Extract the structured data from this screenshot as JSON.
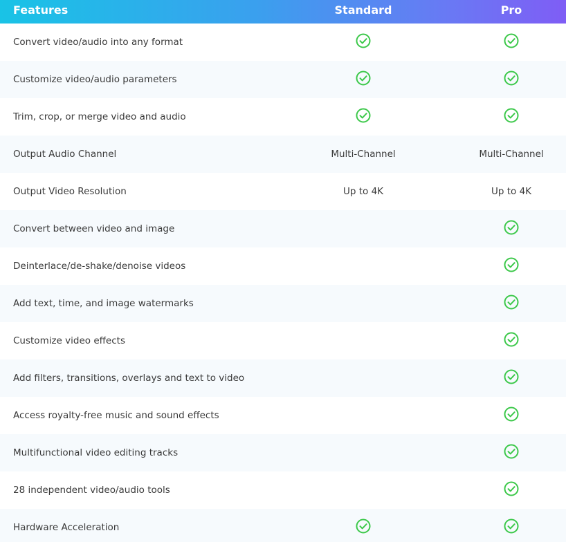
{
  "header": {
    "features": "Features",
    "standard": "Standard",
    "pro": "Pro"
  },
  "colors": {
    "check": "#3cc84a",
    "header_gradient_start": "#19c3e6",
    "header_gradient_end": "#7f5df5"
  },
  "rows": [
    {
      "feature": "Convert video/audio into any format",
      "standard": "check-icon",
      "pro": "check-icon"
    },
    {
      "feature": "Customize video/audio parameters",
      "standard": "check-icon",
      "pro": "check-icon"
    },
    {
      "feature": "Trim, crop, or merge video and audio",
      "standard": "check-icon",
      "pro": "check-icon"
    },
    {
      "feature": "Output Audio Channel",
      "standard_text": "Multi-Channel",
      "pro_text": "Multi-Channel"
    },
    {
      "feature": "Output Video Resolution",
      "standard_text": "Up to 4K",
      "pro_text": "Up to 4K"
    },
    {
      "feature": "Convert between video and image",
      "pro": "check-icon"
    },
    {
      "feature": "Deinterlace/de-shake/denoise videos",
      "pro": "check-icon"
    },
    {
      "feature": "Add text, time, and image watermarks",
      "pro": "check-icon"
    },
    {
      "feature": "Customize video effects",
      "pro": "check-icon"
    },
    {
      "feature": "Add filters, transitions, overlays and text to video",
      "pro": "check-icon"
    },
    {
      "feature": "Access royalty-free music and sound effects",
      "pro": "check-icon"
    },
    {
      "feature": "Multifunctional video editing tracks",
      "pro": "check-icon"
    },
    {
      "feature": "28 independent video/audio tools",
      "pro": "check-icon"
    },
    {
      "feature": "Hardware Acceleration",
      "standard": "check-icon",
      "pro": "check-icon"
    }
  ]
}
